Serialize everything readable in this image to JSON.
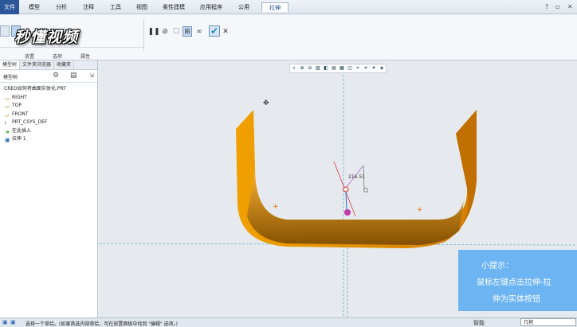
{
  "menu": {
    "file": "文件",
    "tabs": [
      "模型",
      "分析",
      "注释",
      "工具",
      "视图",
      "柔性建模",
      "应用程序",
      "公用"
    ],
    "active_tab": "拉伸"
  },
  "window_controls": {
    "help": "?",
    "restore": "▫",
    "close": "✕"
  },
  "watermark": "秒懂视频",
  "ribbon": {
    "depth_value": "216.51",
    "group_labels": [
      "放置",
      "选项",
      "属性"
    ],
    "buttons": {
      "pause": "pause-icon",
      "no_preview": "no-preview-icon",
      "preview": "preview-icon",
      "verify": "glasses-icon",
      "ok": "check-icon",
      "cancel": "cancel-icon"
    }
  },
  "left_panel": {
    "tabs": [
      "模型树",
      "文件夹浏览器",
      "收藏夹"
    ],
    "tree_label": "模型树",
    "items": [
      {
        "label": "CREO如何将曲面实体化.PRT",
        "icon": "part-icon"
      },
      {
        "label": "RIGHT",
        "icon": "datum-plane-icon"
      },
      {
        "label": "TOP",
        "icon": "datum-plane-icon"
      },
      {
        "label": "FRONT",
        "icon": "datum-plane-icon"
      },
      {
        "label": "PRT_CSYS_DEF",
        "icon": "csys-icon"
      },
      {
        "label": "在此插入",
        "icon": "insert-arrow-icon"
      },
      {
        "label": "拉伸 1",
        "icon": "extrude-icon"
      }
    ]
  },
  "viewport": {
    "dimension_label": "216.51",
    "model_color": "#e08a00",
    "model_shadow": "#8a5200"
  },
  "tip": {
    "title": "小提示：",
    "line1": "鼠标左键点击拉伸-拉",
    "line2": "伸为实体按钮"
  },
  "status": {
    "message": "选择一个草绘。(如果首选内部草绘，可在放置面板中找到 \"编辑\" 选项。)",
    "right_label": "智能",
    "filter": "几何"
  }
}
